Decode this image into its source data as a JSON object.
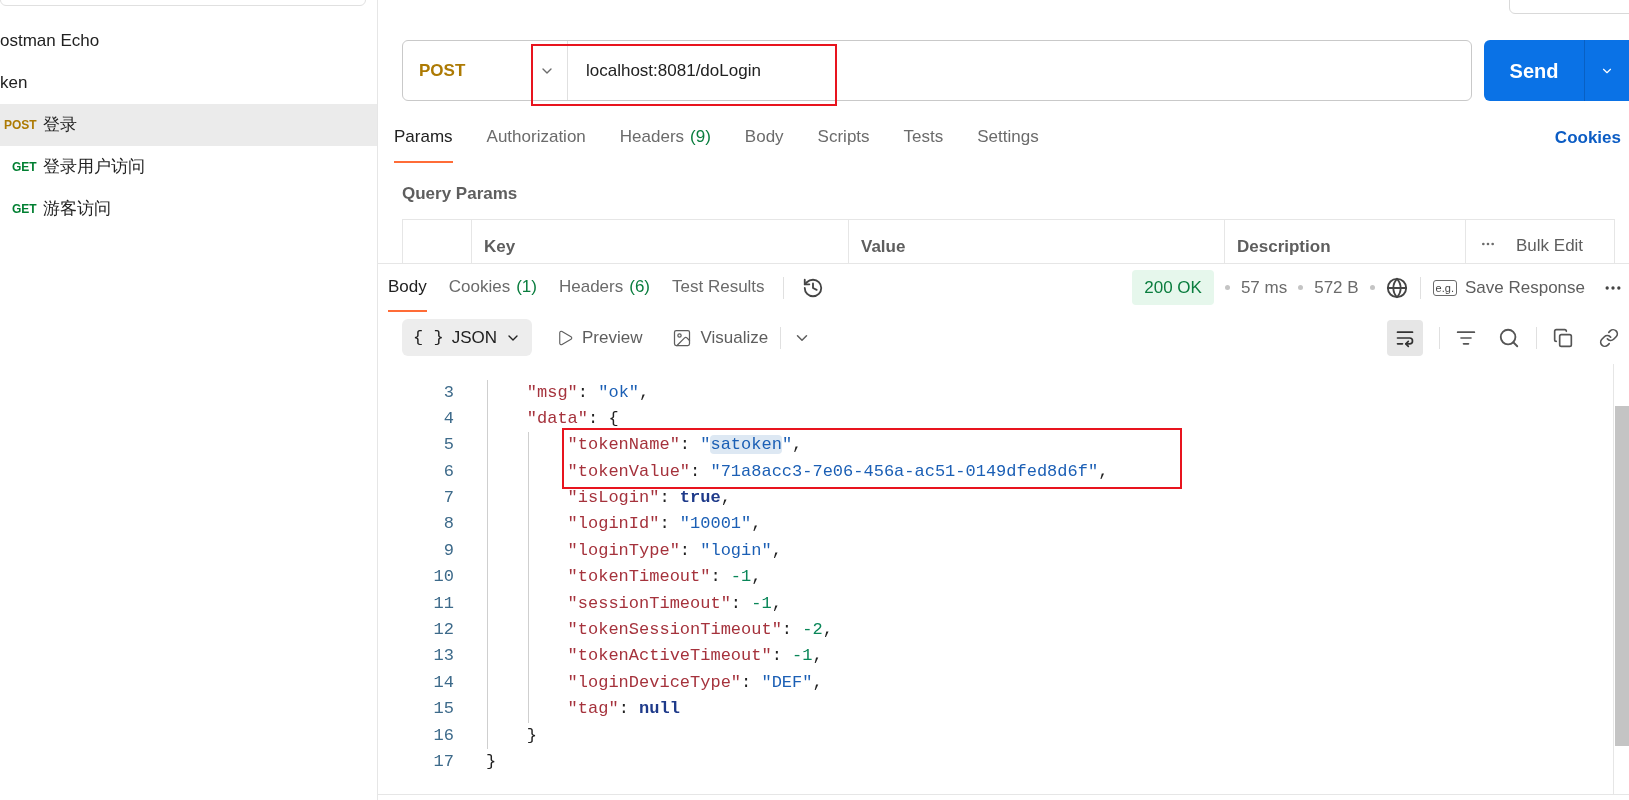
{
  "sidebar": {
    "items": [
      {
        "kind": "collection",
        "name": "ostman Echo",
        "selected": false
      },
      {
        "kind": "collection",
        "name": "ken",
        "selected": false
      },
      {
        "kind": "request",
        "method": "POST",
        "color": "#ad7a03",
        "name": "登录",
        "selected": true
      },
      {
        "kind": "request",
        "method": "GET",
        "color": "#007f31",
        "name": "登录用户访问",
        "selected": false
      },
      {
        "kind": "request",
        "method": "GET",
        "color": "#007f31",
        "name": "游客访问",
        "selected": false
      }
    ]
  },
  "request": {
    "method": "POST",
    "url": "localhost:8081/doLogin",
    "annotated": true,
    "send": "Send"
  },
  "request_tabs": [
    {
      "label": "Params",
      "selected": true
    },
    {
      "label": "Authorization",
      "selected": false
    },
    {
      "label": "Headers",
      "count": "(9)",
      "selected": false
    },
    {
      "label": "Body",
      "selected": false
    },
    {
      "label": "Scripts",
      "selected": false
    },
    {
      "label": "Tests",
      "selected": false
    },
    {
      "label": "Settings",
      "selected": false
    }
  ],
  "cookies_link": "Cookies",
  "query_params": {
    "title": "Query Params",
    "columns": [
      "Key",
      "Value",
      "Description"
    ],
    "bulk_edit": "Bulk Edit"
  },
  "response": {
    "tabs": [
      {
        "label": "Body",
        "selected": true
      },
      {
        "label": "Cookies",
        "count": "(1)",
        "selected": false
      },
      {
        "label": "Headers",
        "count": "(6)",
        "selected": false
      },
      {
        "label": "Test Results",
        "selected": false
      }
    ],
    "status": "200 OK",
    "time": "57 ms",
    "size": "572 B",
    "save_icon_text": "e.g.",
    "save": "Save Response",
    "format": "JSON",
    "format_braces": "{ }",
    "preview": "Preview",
    "visualize": "Visualize",
    "lines": [
      {
        "number": "3",
        "annotated": false,
        "tokens": [
          {
            "kind": "key",
            "text": "    \"msg\""
          },
          {
            "kind": "punct",
            "text": ": "
          },
          {
            "kind": "string",
            "text": "\"ok\""
          },
          {
            "kind": "punct",
            "text": ","
          }
        ]
      },
      {
        "number": "4",
        "annotated": false,
        "tokens": [
          {
            "kind": "key",
            "text": "    \"data\""
          },
          {
            "kind": "punct",
            "text": ": {"
          }
        ]
      },
      {
        "number": "5",
        "annotated": true,
        "tokens": [
          {
            "kind": "key",
            "text": "        \"tokenName\""
          },
          {
            "kind": "punct",
            "text": ": "
          },
          {
            "kind": "string",
            "text": "\""
          },
          {
            "kind": "match",
            "text": "satoken"
          },
          {
            "kind": "string",
            "text": "\""
          },
          {
            "kind": "punct",
            "text": ","
          }
        ]
      },
      {
        "number": "6",
        "annotated": true,
        "tokens": [
          {
            "kind": "key",
            "text": "        \"tokenValue\""
          },
          {
            "kind": "punct",
            "text": ": "
          },
          {
            "kind": "string",
            "text": "\"71a8acc3-7e06-456a-ac51-0149dfed8d6f\""
          },
          {
            "kind": "punct",
            "text": ","
          }
        ]
      },
      {
        "number": "7",
        "annotated": false,
        "tokens": [
          {
            "kind": "key",
            "text": "        \"isLogin\""
          },
          {
            "kind": "punct",
            "text": ": "
          },
          {
            "kind": "keyword",
            "text": "true"
          },
          {
            "kind": "punct",
            "text": ","
          }
        ]
      },
      {
        "number": "8",
        "annotated": false,
        "tokens": [
          {
            "kind": "key",
            "text": "        \"loginId\""
          },
          {
            "kind": "punct",
            "text": ": "
          },
          {
            "kind": "string",
            "text": "\"10001\""
          },
          {
            "kind": "punct",
            "text": ","
          }
        ]
      },
      {
        "number": "9",
        "annotated": false,
        "tokens": [
          {
            "kind": "key",
            "text": "        \"loginType\""
          },
          {
            "kind": "punct",
            "text": ": "
          },
          {
            "kind": "string",
            "text": "\"login\""
          },
          {
            "kind": "punct",
            "text": ","
          }
        ]
      },
      {
        "number": "10",
        "annotated": false,
        "tokens": [
          {
            "kind": "key",
            "text": "        \"tokenTimeout\""
          },
          {
            "kind": "punct",
            "text": ": "
          },
          {
            "kind": "number",
            "text": "-1"
          },
          {
            "kind": "punct",
            "text": ","
          }
        ]
      },
      {
        "number": "11",
        "annotated": false,
        "tokens": [
          {
            "kind": "key",
            "text": "        \"sessionTimeout\""
          },
          {
            "kind": "punct",
            "text": ": "
          },
          {
            "kind": "number",
            "text": "-1"
          },
          {
            "kind": "punct",
            "text": ","
          }
        ]
      },
      {
        "number": "12",
        "annotated": false,
        "tokens": [
          {
            "kind": "key",
            "text": "        \"tokenSessionTimeout\""
          },
          {
            "kind": "punct",
            "text": ": "
          },
          {
            "kind": "number",
            "text": "-2"
          },
          {
            "kind": "punct",
            "text": ","
          }
        ]
      },
      {
        "number": "13",
        "annotated": false,
        "tokens": [
          {
            "kind": "key",
            "text": "        \"tokenActiveTimeout\""
          },
          {
            "kind": "punct",
            "text": ": "
          },
          {
            "kind": "number",
            "text": "-1"
          },
          {
            "kind": "punct",
            "text": ","
          }
        ]
      },
      {
        "number": "14",
        "annotated": false,
        "tokens": [
          {
            "kind": "key",
            "text": "        \"loginDeviceType\""
          },
          {
            "kind": "punct",
            "text": ": "
          },
          {
            "kind": "string",
            "text": "\"DEF\""
          },
          {
            "kind": "punct",
            "text": ","
          }
        ]
      },
      {
        "number": "15",
        "annotated": false,
        "tokens": [
          {
            "kind": "key",
            "text": "        \"tag\""
          },
          {
            "kind": "punct",
            "text": ": "
          },
          {
            "kind": "keyword",
            "text": "null"
          }
        ]
      },
      {
        "number": "16",
        "annotated": false,
        "tokens": [
          {
            "kind": "punct",
            "text": "    }"
          }
        ]
      },
      {
        "number": "17",
        "annotated": false,
        "tokens": [
          {
            "kind": "punct",
            "text": "}"
          }
        ]
      }
    ]
  }
}
